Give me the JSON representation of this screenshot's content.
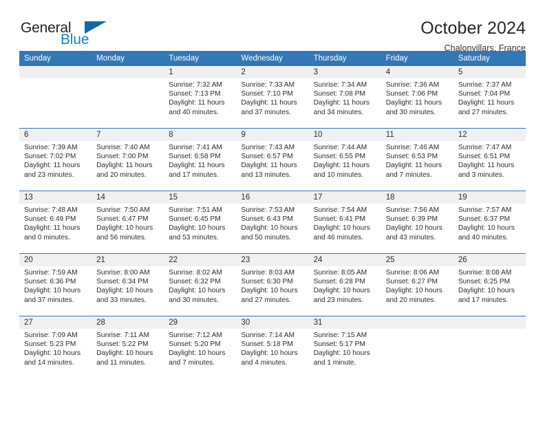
{
  "brand": {
    "name_part1": "General",
    "name_part2": "Blue",
    "flag_icon": "blue-triangle-flag-icon",
    "accent_color": "#1c7fc4"
  },
  "header": {
    "title": "October 2024",
    "subtitle": "Chalonvillars, France"
  },
  "theme": {
    "header_bg": "#3277b8",
    "daynum_bg": "#f0f0f0",
    "grid_line": "#3277b8"
  },
  "weekday_headers": [
    "Sunday",
    "Monday",
    "Tuesday",
    "Wednesday",
    "Thursday",
    "Friday",
    "Saturday"
  ],
  "weeks": [
    [
      {
        "day": "",
        "empty": true
      },
      {
        "day": "",
        "empty": true
      },
      {
        "day": "1",
        "sunrise": "Sunrise: 7:32 AM",
        "sunset": "Sunset: 7:13 PM",
        "daylight": "Daylight: 11 hours and 40 minutes."
      },
      {
        "day": "2",
        "sunrise": "Sunrise: 7:33 AM",
        "sunset": "Sunset: 7:10 PM",
        "daylight": "Daylight: 11 hours and 37 minutes."
      },
      {
        "day": "3",
        "sunrise": "Sunrise: 7:34 AM",
        "sunset": "Sunset: 7:08 PM",
        "daylight": "Daylight: 11 hours and 34 minutes."
      },
      {
        "day": "4",
        "sunrise": "Sunrise: 7:36 AM",
        "sunset": "Sunset: 7:06 PM",
        "daylight": "Daylight: 11 hours and 30 minutes."
      },
      {
        "day": "5",
        "sunrise": "Sunrise: 7:37 AM",
        "sunset": "Sunset: 7:04 PM",
        "daylight": "Daylight: 11 hours and 27 minutes."
      }
    ],
    [
      {
        "day": "6",
        "sunrise": "Sunrise: 7:39 AM",
        "sunset": "Sunset: 7:02 PM",
        "daylight": "Daylight: 11 hours and 23 minutes."
      },
      {
        "day": "7",
        "sunrise": "Sunrise: 7:40 AM",
        "sunset": "Sunset: 7:00 PM",
        "daylight": "Daylight: 11 hours and 20 minutes."
      },
      {
        "day": "8",
        "sunrise": "Sunrise: 7:41 AM",
        "sunset": "Sunset: 6:58 PM",
        "daylight": "Daylight: 11 hours and 17 minutes."
      },
      {
        "day": "9",
        "sunrise": "Sunrise: 7:43 AM",
        "sunset": "Sunset: 6:57 PM",
        "daylight": "Daylight: 11 hours and 13 minutes."
      },
      {
        "day": "10",
        "sunrise": "Sunrise: 7:44 AM",
        "sunset": "Sunset: 6:55 PM",
        "daylight": "Daylight: 11 hours and 10 minutes."
      },
      {
        "day": "11",
        "sunrise": "Sunrise: 7:46 AM",
        "sunset": "Sunset: 6:53 PM",
        "daylight": "Daylight: 11 hours and 7 minutes."
      },
      {
        "day": "12",
        "sunrise": "Sunrise: 7:47 AM",
        "sunset": "Sunset: 6:51 PM",
        "daylight": "Daylight: 11 hours and 3 minutes."
      }
    ],
    [
      {
        "day": "13",
        "sunrise": "Sunrise: 7:48 AM",
        "sunset": "Sunset: 6:49 PM",
        "daylight": "Daylight: 11 hours and 0 minutes."
      },
      {
        "day": "14",
        "sunrise": "Sunrise: 7:50 AM",
        "sunset": "Sunset: 6:47 PM",
        "daylight": "Daylight: 10 hours and 56 minutes."
      },
      {
        "day": "15",
        "sunrise": "Sunrise: 7:51 AM",
        "sunset": "Sunset: 6:45 PM",
        "daylight": "Daylight: 10 hours and 53 minutes."
      },
      {
        "day": "16",
        "sunrise": "Sunrise: 7:53 AM",
        "sunset": "Sunset: 6:43 PM",
        "daylight": "Daylight: 10 hours and 50 minutes."
      },
      {
        "day": "17",
        "sunrise": "Sunrise: 7:54 AM",
        "sunset": "Sunset: 6:41 PM",
        "daylight": "Daylight: 10 hours and 46 minutes."
      },
      {
        "day": "18",
        "sunrise": "Sunrise: 7:56 AM",
        "sunset": "Sunset: 6:39 PM",
        "daylight": "Daylight: 10 hours and 43 minutes."
      },
      {
        "day": "19",
        "sunrise": "Sunrise: 7:57 AM",
        "sunset": "Sunset: 6:37 PM",
        "daylight": "Daylight: 10 hours and 40 minutes."
      }
    ],
    [
      {
        "day": "20",
        "sunrise": "Sunrise: 7:59 AM",
        "sunset": "Sunset: 6:36 PM",
        "daylight": "Daylight: 10 hours and 37 minutes."
      },
      {
        "day": "21",
        "sunrise": "Sunrise: 8:00 AM",
        "sunset": "Sunset: 6:34 PM",
        "daylight": "Daylight: 10 hours and 33 minutes."
      },
      {
        "day": "22",
        "sunrise": "Sunrise: 8:02 AM",
        "sunset": "Sunset: 6:32 PM",
        "daylight": "Daylight: 10 hours and 30 minutes."
      },
      {
        "day": "23",
        "sunrise": "Sunrise: 8:03 AM",
        "sunset": "Sunset: 6:30 PM",
        "daylight": "Daylight: 10 hours and 27 minutes."
      },
      {
        "day": "24",
        "sunrise": "Sunrise: 8:05 AM",
        "sunset": "Sunset: 6:28 PM",
        "daylight": "Daylight: 10 hours and 23 minutes."
      },
      {
        "day": "25",
        "sunrise": "Sunrise: 8:06 AM",
        "sunset": "Sunset: 6:27 PM",
        "daylight": "Daylight: 10 hours and 20 minutes."
      },
      {
        "day": "26",
        "sunrise": "Sunrise: 8:08 AM",
        "sunset": "Sunset: 6:25 PM",
        "daylight": "Daylight: 10 hours and 17 minutes."
      }
    ],
    [
      {
        "day": "27",
        "sunrise": "Sunrise: 7:09 AM",
        "sunset": "Sunset: 5:23 PM",
        "daylight": "Daylight: 10 hours and 14 minutes."
      },
      {
        "day": "28",
        "sunrise": "Sunrise: 7:11 AM",
        "sunset": "Sunset: 5:22 PM",
        "daylight": "Daylight: 10 hours and 11 minutes."
      },
      {
        "day": "29",
        "sunrise": "Sunrise: 7:12 AM",
        "sunset": "Sunset: 5:20 PM",
        "daylight": "Daylight: 10 hours and 7 minutes."
      },
      {
        "day": "30",
        "sunrise": "Sunrise: 7:14 AM",
        "sunset": "Sunset: 5:18 PM",
        "daylight": "Daylight: 10 hours and 4 minutes."
      },
      {
        "day": "31",
        "sunrise": "Sunrise: 7:15 AM",
        "sunset": "Sunset: 5:17 PM",
        "daylight": "Daylight: 10 hours and 1 minute."
      },
      {
        "day": "",
        "empty": true
      },
      {
        "day": "",
        "empty": true
      }
    ]
  ]
}
